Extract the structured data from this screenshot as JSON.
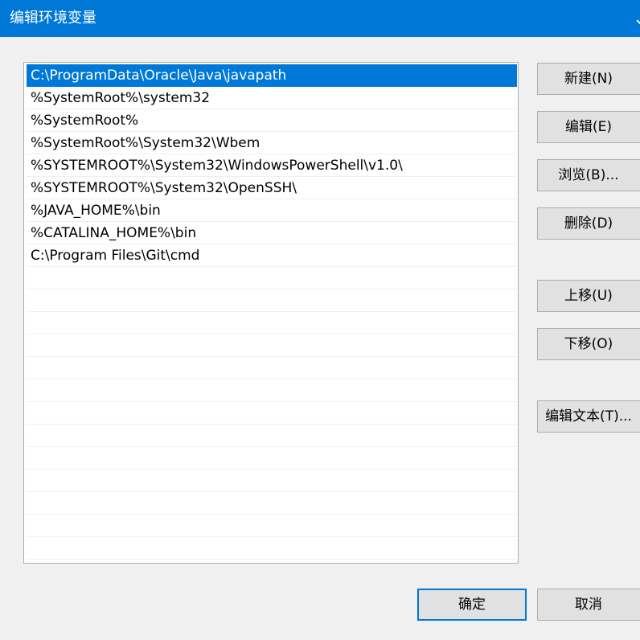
{
  "window": {
    "title": "编辑环境变量"
  },
  "list": {
    "items": [
      "C:\\ProgramData\\Oracle\\Java\\javapath",
      "%SystemRoot%\\system32",
      "%SystemRoot%",
      "%SystemRoot%\\System32\\Wbem",
      "%SYSTEMROOT%\\System32\\WindowsPowerShell\\v1.0\\",
      "%SYSTEMROOT%\\System32\\OpenSSH\\",
      "%JAVA_HOME%\\bin",
      "%CATALINA_HOME%\\bin",
      "C:\\Program Files\\Git\\cmd"
    ],
    "selected_index": 0
  },
  "buttons": {
    "new": "新建(N)",
    "edit": "编辑(E)",
    "browse": "浏览(B)...",
    "delete": "删除(D)",
    "move_up": "上移(U)",
    "move_down": "下移(O)",
    "edit_text": "编辑文本(T)...",
    "ok": "确定",
    "cancel": "取消"
  },
  "colors": {
    "accent": "#0078d7",
    "background": "#f0f0f0"
  }
}
